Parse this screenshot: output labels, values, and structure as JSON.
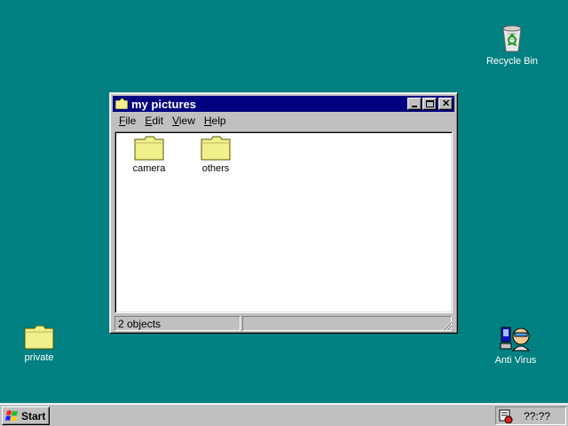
{
  "desktop": {
    "icons": [
      {
        "label": "Recycle Bin",
        "icon": "recycle-bin-icon"
      },
      {
        "label": "private",
        "icon": "folder-icon"
      },
      {
        "label": "Anti Virus",
        "icon": "antivirus-icon"
      }
    ]
  },
  "window": {
    "title": "my pictures",
    "menu": [
      {
        "label": "File",
        "accel": "F",
        "rest": "ile"
      },
      {
        "label": "Edit",
        "accel": "E",
        "rest": "dit"
      },
      {
        "label": "View",
        "accel": "V",
        "rest": "iew"
      },
      {
        "label": "Help",
        "accel": "H",
        "rest": "elp"
      }
    ],
    "items": [
      {
        "label": "camera",
        "icon": "folder-icon"
      },
      {
        "label": "others",
        "icon": "folder-icon"
      }
    ],
    "status": "2 objects"
  },
  "taskbar": {
    "start_label": "Start",
    "clock": "??:??"
  },
  "colors": {
    "desktop": "#008080",
    "title_active": "#000080",
    "chrome": "#c0c0c0",
    "folder": "#f0f08c"
  }
}
